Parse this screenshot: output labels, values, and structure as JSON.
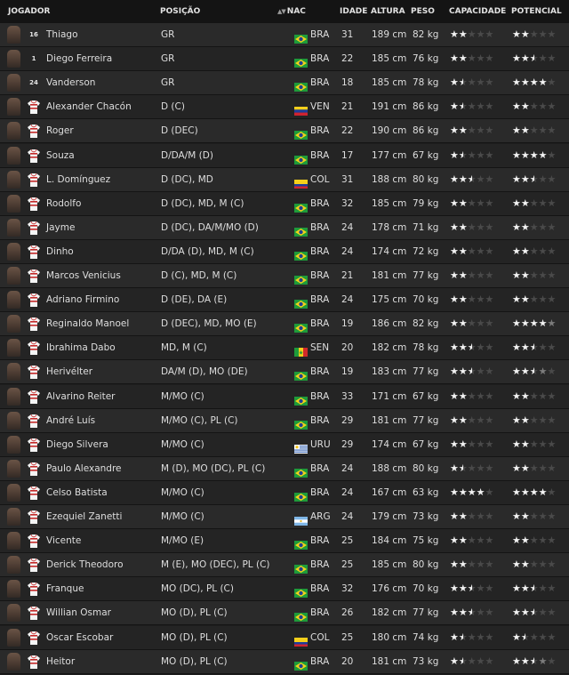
{
  "columns": {
    "player": "JOGADOR",
    "position": "POSIÇÃO",
    "sort_indicator": "▲▼",
    "nat": "NAC",
    "age": "IDADE",
    "height": "ALTURA",
    "weight": "PESO",
    "ability": "CAPACIDADE",
    "potential": "POTENCIAL"
  },
  "rows": [
    {
      "number": "16",
      "name": "Thiago",
      "position": "GR",
      "flag": "br",
      "nat": "BRA",
      "age": "31",
      "height": "189 cm",
      "weight": "82 kg",
      "ability": "ffeee",
      "potential": "ffeee",
      "kit": "gk"
    },
    {
      "number": "1",
      "name": "Diego Ferreira",
      "position": "GR",
      "flag": "br",
      "nat": "BRA",
      "age": "22",
      "height": "185 cm",
      "weight": "76 kg",
      "ability": "ffeee",
      "potential": "ffhee",
      "kit": "gk"
    },
    {
      "number": "24",
      "name": "Vanderson",
      "position": "GR",
      "flag": "br",
      "nat": "BRA",
      "age": "18",
      "height": "185 cm",
      "weight": "78 kg",
      "ability": "fheee",
      "potential": "ffffe",
      "kit": "gk"
    },
    {
      "number": "",
      "name": "Alexander Chacón",
      "position": "D (C)",
      "flag": "ve",
      "nat": "VEN",
      "age": "21",
      "height": "191 cm",
      "weight": "86 kg",
      "ability": "fheee",
      "potential": "ffeee",
      "kit": "out"
    },
    {
      "number": "",
      "name": "Roger",
      "position": "D (DEC)",
      "flag": "br",
      "nat": "BRA",
      "age": "22",
      "height": "190 cm",
      "weight": "86 kg",
      "ability": "ffeee",
      "potential": "ffeee",
      "kit": "out"
    },
    {
      "number": "",
      "name": "Souza",
      "position": "D/DA/M (D)",
      "flag": "br",
      "nat": "BRA",
      "age": "17",
      "height": "177 cm",
      "weight": "67 kg",
      "ability": "fheee",
      "potential": "ffffe",
      "kit": "out"
    },
    {
      "number": "",
      "name": "L. Domínguez",
      "position": "D (DC), MD",
      "flag": "co",
      "nat": "COL",
      "age": "31",
      "height": "188 cm",
      "weight": "80 kg",
      "ability": "ffhee",
      "potential": "ffhee",
      "kit": "out"
    },
    {
      "number": "",
      "name": "Rodolfo",
      "position": "D (DC), MD, M (C)",
      "flag": "br",
      "nat": "BRA",
      "age": "32",
      "height": "185 cm",
      "weight": "79 kg",
      "ability": "ffeee",
      "potential": "ffeee",
      "kit": "out"
    },
    {
      "number": "",
      "name": "Jayme",
      "position": "D (DC), DA/M/MO (D)",
      "flag": "br",
      "nat": "BRA",
      "age": "24",
      "height": "178 cm",
      "weight": "71 kg",
      "ability": "ffeee",
      "potential": "ffeee",
      "kit": "out"
    },
    {
      "number": "",
      "name": "Dinho",
      "position": "D/DA (D), MD, M (C)",
      "flag": "br",
      "nat": "BRA",
      "age": "24",
      "height": "174 cm",
      "weight": "72 kg",
      "ability": "ffeee",
      "potential": "ffeee",
      "kit": "out"
    },
    {
      "number": "",
      "name": "Marcos Venicius",
      "position": "D (C), MD, M (C)",
      "flag": "br",
      "nat": "BRA",
      "age": "21",
      "height": "181 cm",
      "weight": "77 kg",
      "ability": "ffeee",
      "potential": "ffeee",
      "kit": "out"
    },
    {
      "number": "",
      "name": "Adriano Firmino",
      "position": "D (DE), DA (E)",
      "flag": "br",
      "nat": "BRA",
      "age": "24",
      "height": "175 cm",
      "weight": "70 kg",
      "ability": "ffeee",
      "potential": "ffeee",
      "kit": "out"
    },
    {
      "number": "",
      "name": "Reginaldo Manoel",
      "position": "D (DEC), MD, MO (E)",
      "flag": "br",
      "nat": "BRA",
      "age": "19",
      "height": "186 cm",
      "weight": "82 kg",
      "ability": "ffeee",
      "potential": "ffffx",
      "kit": "out"
    },
    {
      "number": "",
      "name": "Ibrahima Dabo",
      "position": "MD, M (C)",
      "flag": "sn",
      "nat": "SEN",
      "age": "20",
      "height": "182 cm",
      "weight": "78 kg",
      "ability": "ffhee",
      "potential": "ffhee",
      "kit": "out"
    },
    {
      "number": "",
      "name": "Herivélter",
      "position": "DA/M (D), MO (DE)",
      "flag": "br",
      "nat": "BRA",
      "age": "19",
      "height": "183 cm",
      "weight": "77 kg",
      "ability": "ffhee",
      "potential": "ffhxe",
      "kit": "out"
    },
    {
      "number": "",
      "name": "Alvarino Reiter",
      "position": "M/MO (C)",
      "flag": "br",
      "nat": "BRA",
      "age": "33",
      "height": "171 cm",
      "weight": "67 kg",
      "ability": "ffeee",
      "potential": "ffeee",
      "kit": "out"
    },
    {
      "number": "",
      "name": "André Luís",
      "position": "M/MO (C), PL (C)",
      "flag": "br",
      "nat": "BRA",
      "age": "29",
      "height": "181 cm",
      "weight": "77 kg",
      "ability": "ffeee",
      "potential": "ffeee",
      "kit": "out"
    },
    {
      "number": "",
      "name": "Diego Silvera",
      "position": "M/MO (C)",
      "flag": "uy",
      "nat": "URU",
      "age": "29",
      "height": "174 cm",
      "weight": "67 kg",
      "ability": "ffeee",
      "potential": "ffeee",
      "kit": "out"
    },
    {
      "number": "",
      "name": "Paulo Alexandre",
      "position": "M (D), MO (DC), PL (C)",
      "flag": "br",
      "nat": "BRA",
      "age": "24",
      "height": "188 cm",
      "weight": "80 kg",
      "ability": "fheee",
      "potential": "ffeee",
      "kit": "out"
    },
    {
      "number": "",
      "name": "Celso Batista",
      "position": "M/MO (C)",
      "flag": "br",
      "nat": "BRA",
      "age": "24",
      "height": "167 cm",
      "weight": "63 kg",
      "ability": "ffffe",
      "potential": "ffffe",
      "kit": "out"
    },
    {
      "number": "",
      "name": "Ezequiel Zanetti",
      "position": "M/MO (C)",
      "flag": "ar",
      "nat": "ARG",
      "age": "24",
      "height": "179 cm",
      "weight": "73 kg",
      "ability": "ffeee",
      "potential": "ffeee",
      "kit": "out"
    },
    {
      "number": "",
      "name": "Vicente",
      "position": "M/MO (E)",
      "flag": "br",
      "nat": "BRA",
      "age": "25",
      "height": "184 cm",
      "weight": "75 kg",
      "ability": "ffeee",
      "potential": "ffeee",
      "kit": "out"
    },
    {
      "number": "",
      "name": "Derick Theodoro",
      "position": "M (E), MO (DEC), PL (C)",
      "flag": "br",
      "nat": "BRA",
      "age": "25",
      "height": "185 cm",
      "weight": "80 kg",
      "ability": "ffeee",
      "potential": "ffeee",
      "kit": "out"
    },
    {
      "number": "",
      "name": "Franque",
      "position": "MO (DC), PL (C)",
      "flag": "br",
      "nat": "BRA",
      "age": "32",
      "height": "176 cm",
      "weight": "70 kg",
      "ability": "ffhee",
      "potential": "ffhee",
      "kit": "out"
    },
    {
      "number": "",
      "name": "Willian Osmar",
      "position": "MO (D), PL (C)",
      "flag": "br",
      "nat": "BRA",
      "age": "26",
      "height": "182 cm",
      "weight": "77 kg",
      "ability": "ffhee",
      "potential": "ffhee",
      "kit": "out"
    },
    {
      "number": "",
      "name": "Oscar Escobar",
      "position": "MO (D), PL (C)",
      "flag": "co",
      "nat": "COL",
      "age": "25",
      "height": "180 cm",
      "weight": "74 kg",
      "ability": "fheee",
      "potential": "fheee",
      "kit": "out"
    },
    {
      "number": "",
      "name": "Heitor",
      "position": "MO (D), PL (C)",
      "flag": "br",
      "nat": "BRA",
      "age": "20",
      "height": "181 cm",
      "weight": "73 kg",
      "ability": "fheee",
      "potential": "ffhxe",
      "kit": "out"
    }
  ],
  "colors": {
    "background": "#1e1e1e",
    "header": "#141414",
    "row_even": "#2a2a2a",
    "row_odd": "#242424",
    "star": "#f2f2f2",
    "star_empty": "#4a4a4a"
  },
  "icons": {
    "face": "player-face-icon",
    "shirt": "shirt-icon",
    "flag": "flag-icon",
    "star": "star-icon"
  }
}
